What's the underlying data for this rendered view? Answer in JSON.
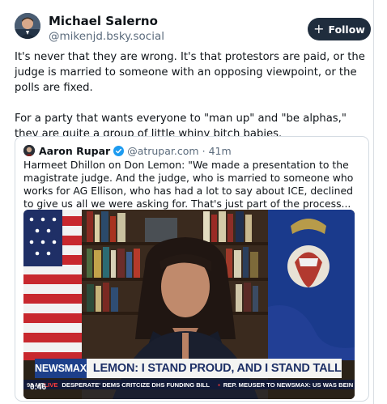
{
  "author": {
    "display_name": "Michael Salerno",
    "handle": "@mikenjd.bsky.social"
  },
  "follow_button": {
    "label": "Follow",
    "icon": "plus-icon"
  },
  "post": {
    "paragraphs": [
      "It's never that they are wrong. It's that protestors are paid, or the judge is married to someone with an opposing viewpoint, or the polls are fixed.",
      "For a party that wants everyone to \"man up\" and \"be alphas,\" they are quite a group of little whiny bitch babies."
    ]
  },
  "quote": {
    "display_name": "Aaron Rupar",
    "handle": "@atrupar.com",
    "separator": "·",
    "time_ago": "41m",
    "text": "Harmeet Dhillon on Don Lemon: \"We made a presentation to the magistrate judge. And the judge, who is married to someone who works for AG Ellison, who has had a lot to say about ICE, declined to give us all we were asking for. That's just part of the process... there are other ways to pursue charges\"",
    "video": {
      "network_logo": "NEWSMAX",
      "headline": "LEMON: I STAND PROUD, AND I STAND TALL",
      "ticker_time": "93 MT",
      "ticker_live": "LIVE",
      "ticker_story_1": "DESPERATE' DEMS CRITCIZE DHS FUNDING BILL",
      "ticker_story_2": "REP. MEUSER TO NEWSMAX: US WAS BEIN",
      "timestamp": "0:46"
    }
  },
  "colors": {
    "follow_bg": "#1f2d3d",
    "verified": "#1d9bf0",
    "network_blue": "#1d3f8a",
    "ticker_bg": "#121a38"
  }
}
